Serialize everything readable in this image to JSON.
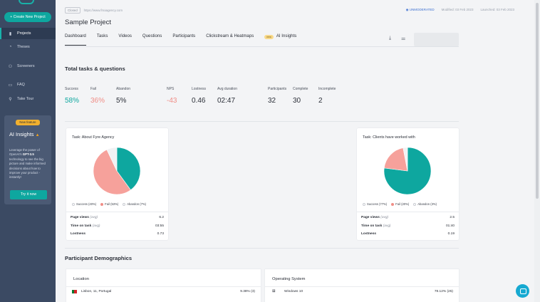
{
  "sidebar": {
    "create_label": "+ Create New Project",
    "items": [
      {
        "label": "Projects",
        "icon": "projects-icon"
      },
      {
        "label": "Theses",
        "icon": "palette-icon"
      },
      {
        "label": "Screeners",
        "icon": "screeners-icon"
      },
      {
        "label": "FAQ",
        "icon": "faq-icon"
      },
      {
        "label": "Take Tour",
        "icon": "pin-icon"
      }
    ],
    "ai_card": {
      "badge": "New feature",
      "title": "AI Insights",
      "desc_pre": "Leverage the power of OpenAI's ",
      "desc_bold": "GPT-3.5",
      "desc_post": " technology to see the big picture and make informed decisions about how to improve your product - instantly!",
      "cta": "Try it now"
    }
  },
  "header": {
    "status": "Closed",
    "url": "https://www.fmaagency.com",
    "mode": "UNMODERATED",
    "modified": "Modified: 03 Feb 2023",
    "launched": "Launched: 03 Feb 2023",
    "title": "Sample Project"
  },
  "tabs": [
    {
      "label": "Dashboard"
    },
    {
      "label": "Tasks"
    },
    {
      "label": "Videos"
    },
    {
      "label": "Questions"
    },
    {
      "label": "Participants"
    },
    {
      "label": "Clickstream & Heatmaps"
    },
    {
      "label": "AI Insights",
      "badge": "new"
    }
  ],
  "summary": {
    "title": "Total tasks & questions",
    "stats": [
      {
        "label": "Success",
        "value": "58%",
        "color": "#0ea79f"
      },
      {
        "label": "Fail",
        "value": "36%",
        "color": "#f08d86"
      },
      {
        "label": "Abandon",
        "value": "5%",
        "color": "#2b2f38"
      },
      {
        "label": "NPS",
        "value": "-43",
        "color": "#f08d86"
      },
      {
        "label": "Lostness",
        "value": "0.46",
        "color": "#2b2f38"
      },
      {
        "label": "Avg duration",
        "value": "02:47",
        "color": "#2b2f38"
      },
      {
        "label": "Participants",
        "value": "32",
        "color": "#2b2f38"
      },
      {
        "label": "Complete",
        "value": "30",
        "color": "#2b2f38"
      },
      {
        "label": "Incomplete",
        "value": "2",
        "color": "#2b2f38"
      }
    ]
  },
  "colors": {
    "success": "#0ea79f",
    "fail": "#f6a19b",
    "abandon": "#f1f2f4"
  },
  "tasks": [
    {
      "title": "Task: About Fyre Agency",
      "legend": [
        "Success (40%)",
        "Fail (53%)",
        "Abandon (7%)"
      ],
      "slices": [
        0.4,
        0.53,
        0.07
      ],
      "metrics": [
        {
          "key": "Page views",
          "hint": "(avg)",
          "value": "6.2"
        },
        {
          "key": "Time on task",
          "hint": "(avg)",
          "value": "03:55"
        },
        {
          "key": "Lostness",
          "hint": "",
          "value": "0.73"
        }
      ]
    },
    {
      "title": "Task: Clients have worked with",
      "legend": [
        "Success (77%)",
        "Fail (20%)",
        "Abandon (3%)"
      ],
      "slices": [
        0.77,
        0.2,
        0.03
      ],
      "metrics": [
        {
          "key": "Page views",
          "hint": "(avg)",
          "value": "2.5"
        },
        {
          "key": "Time on task",
          "hint": "(avg)",
          "value": "01:40"
        },
        {
          "key": "Lostness",
          "hint": "",
          "value": "0.19"
        }
      ]
    }
  ],
  "demographics": {
    "title": "Participant Demographics",
    "location": {
      "head": "Location",
      "row_name": "Lisbon, 11, Portugal",
      "row_value": "9.38% (3)"
    },
    "os": {
      "head": "Operating System",
      "row_name": "Windows 10",
      "row_value": "78.12% (25)"
    }
  }
}
